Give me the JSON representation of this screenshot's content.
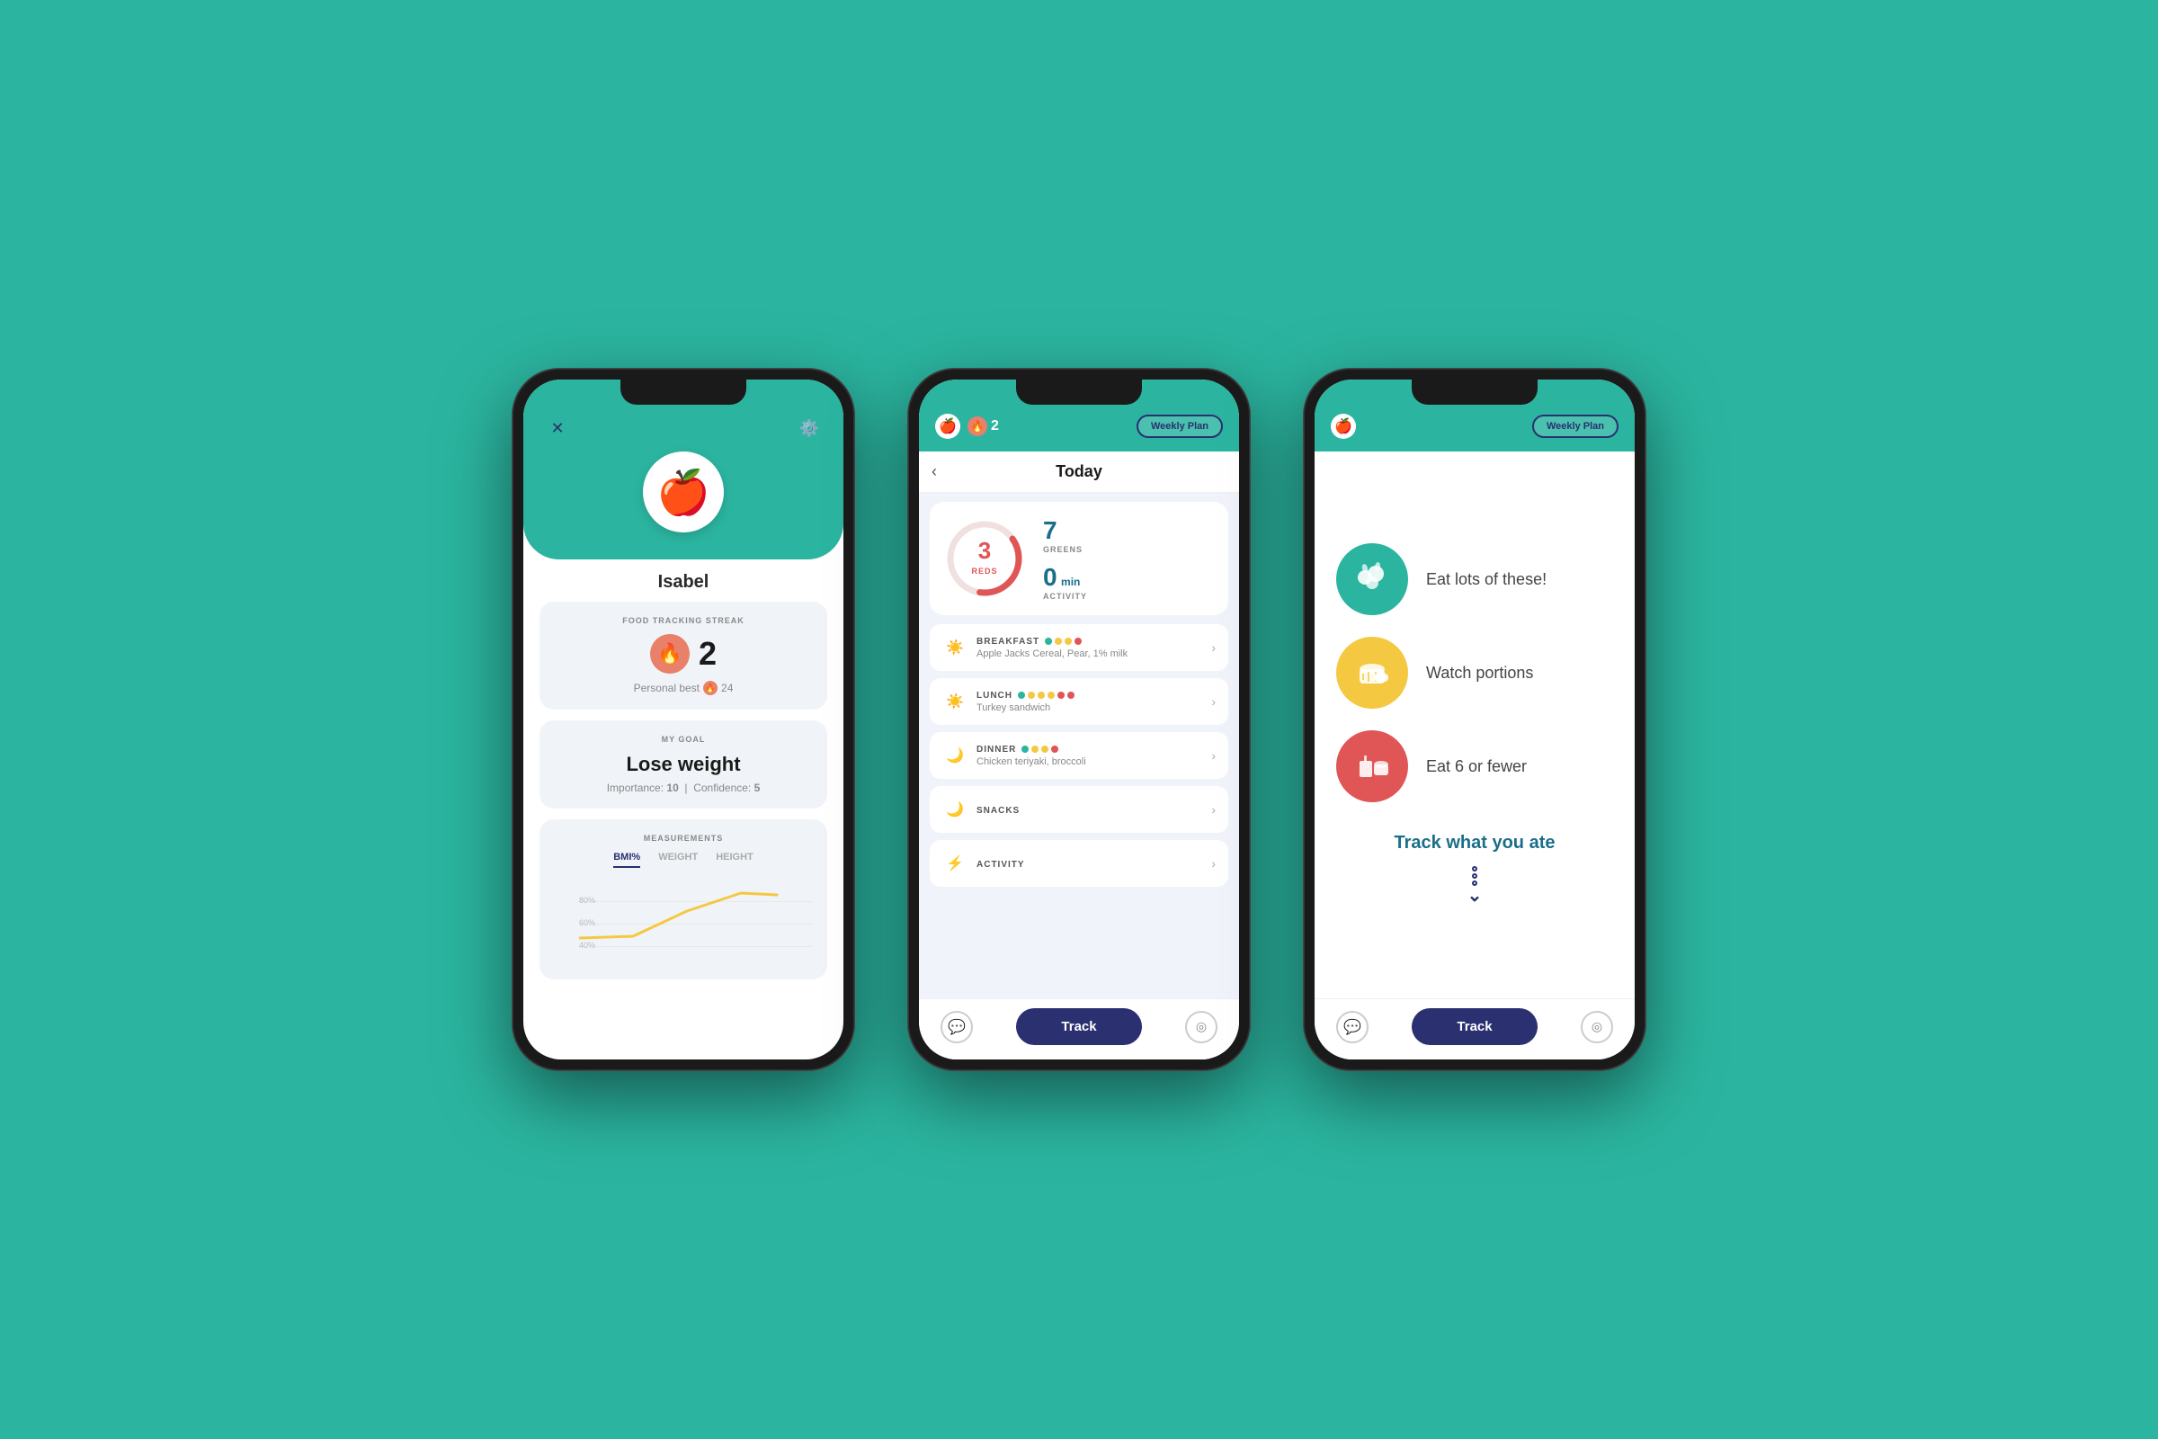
{
  "background_color": "#2bb5a0",
  "phone1": {
    "user": {
      "name": "Isabel",
      "avatar_emoji": "🍎"
    },
    "streak": {
      "label": "FOOD TRACKING STREAK",
      "value": "2",
      "icon": "🔥",
      "personal_best_label": "Personal best",
      "personal_best_value": "24"
    },
    "goal": {
      "label": "MY GOAL",
      "value": "Lose weight",
      "importance_label": "Importance:",
      "importance_value": "10",
      "confidence_label": "Confidence:",
      "confidence_value": "5"
    },
    "measurements": {
      "label": "MEASUREMENTS",
      "tabs": [
        "BMI%",
        "WEIGHT",
        "HEIGHT"
      ],
      "active_tab": "BMI%",
      "chart_labels": [
        "80%",
        "60%",
        "40%"
      ]
    }
  },
  "phone2": {
    "header": {
      "streak_value": "2",
      "weekly_plan_label": "Weekly Plan"
    },
    "today_title": "Today",
    "stats": {
      "reds_value": "3",
      "reds_label": "REDS",
      "greens_value": "7",
      "greens_label": "GREENS",
      "activity_value": "0",
      "activity_unit": "min",
      "activity_label": "ACTIVITY"
    },
    "meals": [
      {
        "name": "BREAKFAST",
        "description": "Apple Jacks Cereal, Pear, 1% milk",
        "icon": "☀️",
        "dots": [
          "green",
          "yellow",
          "yellow",
          "red"
        ]
      },
      {
        "name": "LUNCH",
        "description": "Turkey sandwich",
        "icon": "☀️",
        "dots": [
          "green",
          "yellow",
          "yellow",
          "yellow",
          "red",
          "red"
        ]
      },
      {
        "name": "DINNER",
        "description": "Chicken teriyaki, broccoli",
        "icon": "🌙",
        "dots": [
          "green",
          "yellow",
          "yellow",
          "red"
        ]
      },
      {
        "name": "SNACKS",
        "description": "",
        "icon": "🌙",
        "dots": []
      },
      {
        "name": "ACTIVITY",
        "description": "",
        "icon": "⚡",
        "dots": []
      }
    ],
    "track_label": "Track"
  },
  "phone3": {
    "header": {
      "weekly_plan_label": "Weekly Plan"
    },
    "food_categories": [
      {
        "color": "green",
        "emoji": "🥗",
        "label": "Eat lots of these!"
      },
      {
        "color": "yellow",
        "emoji": "🌾",
        "label": "Watch portions"
      },
      {
        "color": "red",
        "emoji": "🥤",
        "label": "Eat 6 or fewer"
      }
    ],
    "track_section": {
      "title": "Track what you ate",
      "arrow_dots": 3
    },
    "track_label": "Track"
  }
}
